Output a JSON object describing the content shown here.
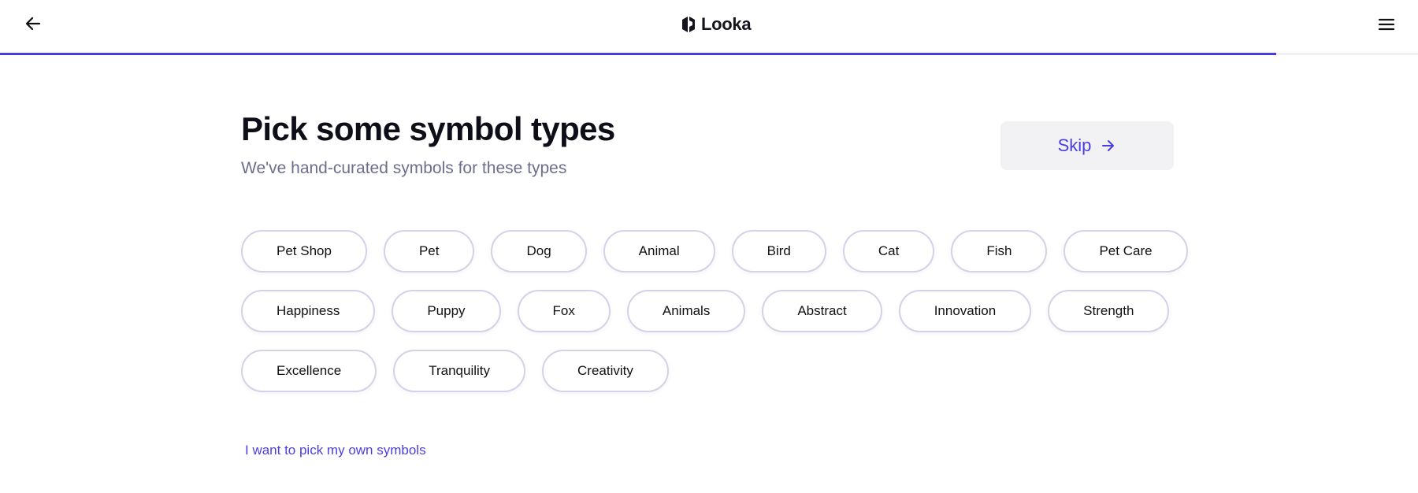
{
  "header": {
    "brand": "Looka",
    "icons": {
      "back": "arrow-left-icon",
      "logo": "looka-logo-icon",
      "menu": "hamburger-menu-icon"
    },
    "progress_percent": 90
  },
  "main": {
    "title": "Pick some symbol types",
    "subtitle": "We've hand-curated symbols for these types",
    "skip_label": "Skip",
    "skip_icon": "arrow-right-icon",
    "chip_rows": [
      [
        "Pet Shop",
        "Pet",
        "Dog",
        "Animal",
        "Bird",
        "Cat",
        "Fish",
        "Pet Care"
      ],
      [
        "Happiness",
        "Puppy",
        "Fox",
        "Animals",
        "Abstract",
        "Innovation",
        "Strength"
      ],
      [
        "Excellence",
        "Tranquility",
        "Creativity"
      ]
    ],
    "own_symbols_link": "I want to pick my own symbols"
  },
  "colors": {
    "accent": "#4a3ee0",
    "chip_border": "#d3d2e6",
    "subtitle": "#6b6e8c",
    "skip_bg": "#f2f2f4"
  }
}
